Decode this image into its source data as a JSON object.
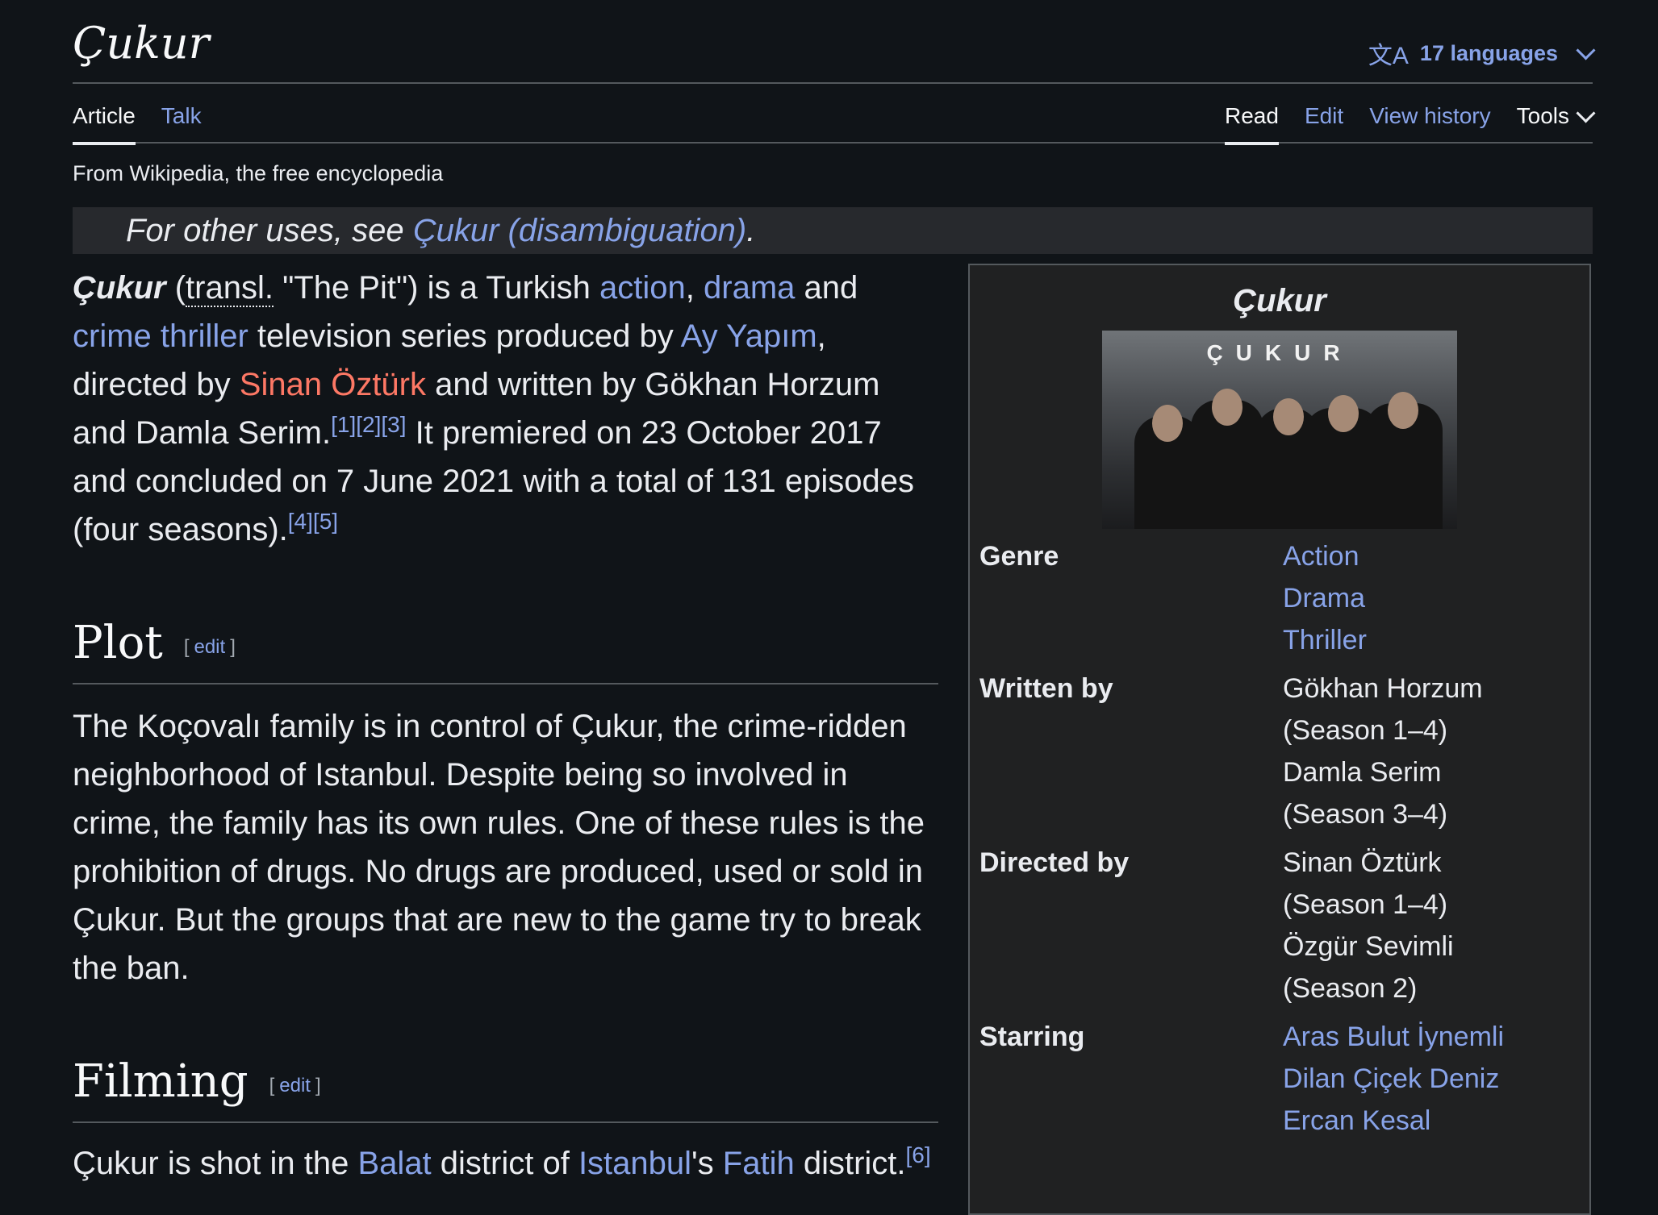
{
  "header": {
    "title": "Çukur",
    "languages_label": "17 languages",
    "language_icon": "文A"
  },
  "tabs_left": {
    "article": "Article",
    "talk": "Talk"
  },
  "tabs_right": {
    "read": "Read",
    "edit": "Edit",
    "history": "View history",
    "tools": "Tools"
  },
  "tagline": "From Wikipedia, the free encyclopedia",
  "hatnote": {
    "prefix": "For other uses, see ",
    "link": "Çukur (disambiguation)",
    "suffix": "."
  },
  "intro": {
    "bold_title": "Çukur",
    "paren_open": " (",
    "transl": "transl.",
    "transl_text": " \"The Pit\") is a Turkish ",
    "link_action": "action",
    "comma1": ", ",
    "link_drama": "drama",
    "and1": " and ",
    "link_crime": "crime thriller",
    "text2": " television series produced by ",
    "link_ay": "Ay Yapım",
    "text3": ", directed by ",
    "link_sinan": "Sinan Öztürk",
    "text4": " and written by Gökhan Horzum and Damla Serim.",
    "ref1": "[1][2][3]",
    "text5": " It premiered on 23 October 2017 and concluded on 7 June 2021 with a total of 131 episodes (four seasons).",
    "ref2": "[4][5]"
  },
  "plot": {
    "heading": "Plot",
    "edit_open": "[",
    "edit_label": "edit",
    "edit_close": "]",
    "text": "The Koçovalı family is in control of Çukur, the crime-ridden neighborhood of Istanbul. Despite being so involved in crime, the family has its own rules. One of these rules is the prohibition of drugs. No drugs are produced, used or sold in Çukur. But the groups that are new to the game try to break the ban."
  },
  "filming": {
    "heading": "Filming",
    "edit_open": "[",
    "edit_label": "edit",
    "edit_close": "]",
    "text1": "Çukur is shot in the ",
    "link_balat": "Balat",
    "text2": " district of ",
    "link_istanbul": "Istanbul",
    "text3": "'s ",
    "link_fatih": "Fatih",
    "text4": " district.",
    "ref": "[6]"
  },
  "infobox": {
    "title": "Çukur",
    "image_text": "ÇUKUR",
    "genre_label": "Genre",
    "genres": [
      "Action",
      "Drama",
      "Thriller"
    ],
    "written_label": "Written by",
    "written": [
      "Gökhan Horzum",
      "(Season 1–4)",
      "Damla Serim",
      "(Season 3–4)"
    ],
    "directed_label": "Directed by",
    "directed": [
      "Sinan Öztürk",
      "(Season 1–4)",
      "Özgür Sevimli",
      "(Season 2)"
    ],
    "starring_label": "Starring",
    "starring": [
      "Aras Bulut İynemli",
      "Dilan Çiçek Deniz",
      "Ercan Kesal"
    ]
  }
}
